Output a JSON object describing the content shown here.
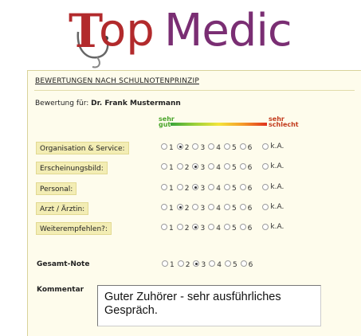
{
  "logo": {
    "t": "T",
    "op": "op",
    "medic": "Medic"
  },
  "page": {
    "heading": "BEWERTUNGEN NACH SCHULNOTENPRINZIP",
    "for_label": "Bewertung für:",
    "doctor": "Dr. Frank Mustermann"
  },
  "scale": {
    "good": "sehr gut",
    "good_1": "sehr",
    "good_2": "gut",
    "bad_1": "sehr",
    "bad_2": "schlecht"
  },
  "criteria": [
    {
      "label": "Organisation & Service:",
      "selected": "2"
    },
    {
      "label": "Erscheinungsbild:",
      "selected": "3"
    },
    {
      "label": "Personal:",
      "selected": "3"
    },
    {
      "label": "Arzt / Ärztin:",
      "selected": "2"
    },
    {
      "label": "Weiterempfehlen?:",
      "selected": "3"
    }
  ],
  "options": [
    "1",
    "2",
    "3",
    "4",
    "5",
    "6"
  ],
  "ka_label": "k.A.",
  "gesamt": {
    "label": "Gesamt-Note",
    "selected": "3"
  },
  "kommentar": {
    "label": "Kommentar",
    "text": "Guter Zuhörer - sehr ausführliches Gespräch."
  },
  "colors": {
    "brand_red": "#b22a2c",
    "brand_purple": "#7a2e73",
    "panel_bg": "#fefcec",
    "label_bg": "#f3edb4"
  }
}
